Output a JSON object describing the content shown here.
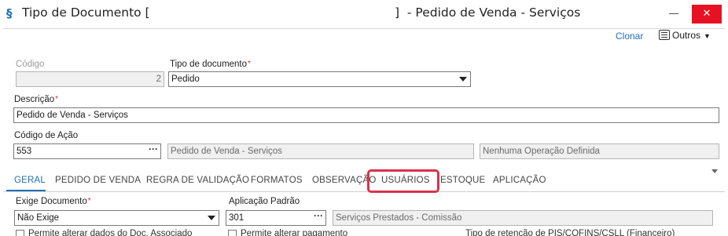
{
  "window": {
    "title_left": "Tipo de Documento [",
    "title_right": "]  - Pedido de Venda - Serviços",
    "minimize_glyph": "—",
    "close_glyph": "✕",
    "logo_glyph": "§"
  },
  "toolbar": {
    "clonar_label": "Clonar",
    "outros_label": "Outros"
  },
  "form": {
    "codigo": {
      "label": "Código",
      "value": "2"
    },
    "tipo_documento": {
      "label": "Tipo de documento",
      "value": "Pedido"
    },
    "descricao": {
      "label": "Descrição",
      "value": "Pedido de Venda - Serviços"
    },
    "codigo_acao": {
      "label": "Código de Ação",
      "value": "553",
      "description": "Pedido de Venda - Serviços",
      "operation": "Nenhuma Operação Definida"
    }
  },
  "tabs": [
    {
      "label": "GERAL",
      "active": true
    },
    {
      "label": "PEDIDO DE VENDA"
    },
    {
      "label": "REGRA DE VALIDAÇÃO"
    },
    {
      "label": "FORMATOS"
    },
    {
      "label": "OBSERVAÇÃO"
    },
    {
      "label": "USUÁRIOS",
      "highlighted": true
    },
    {
      "label": "ESTOQUE"
    },
    {
      "label": "APLICAÇÃO"
    }
  ],
  "geral": {
    "exige_documento": {
      "label": "Exige Documento",
      "value": "Não Exige"
    },
    "aplicacao_padrao": {
      "label": "Aplicação Padrão",
      "value": "301",
      "description": "Serviços Prestados - Comissão"
    },
    "partial_row": {
      "left": "Permite alterar dados do Doc. Associado",
      "middle": "Permite alterar pagamento",
      "right": "Tipo de retenção de PIS/COFINS/CSLL (Financeiro)"
    }
  },
  "colors": {
    "accent": "#1e6fb8",
    "highlight": "#d8334a",
    "required": "#d32f2f"
  }
}
